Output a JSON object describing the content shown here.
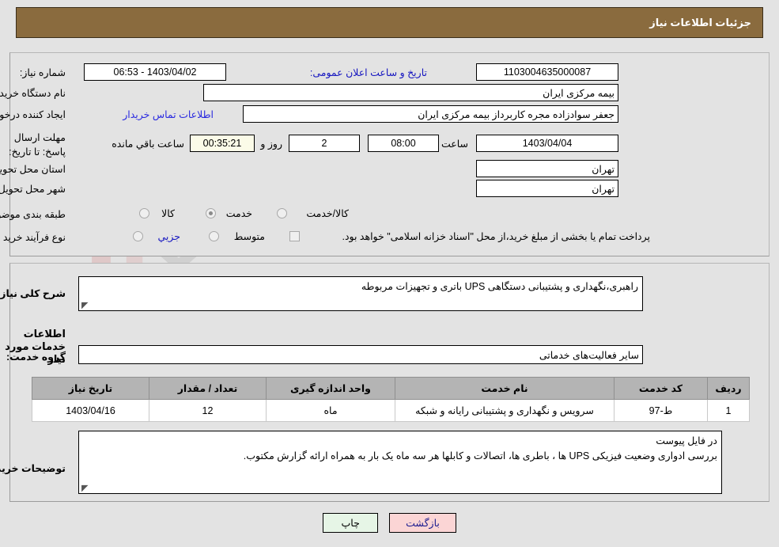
{
  "header": {
    "title": "جزئیات اطلاعات نیاز"
  },
  "watermark": {
    "text": "AnaTender.net"
  },
  "top_panel": {
    "need_number_label": "شماره نیاز:",
    "need_number_value": "1103004635000087",
    "public_announce_label": "تاریخ و ساعت اعلان عمومی:",
    "public_announce_value": "1403/04/02 - 06:53",
    "buyer_org_label": "نام دستگاه خریدار:",
    "buyer_org_value": "بیمه مرکزی ایران",
    "creator_label": "ایجاد کننده درخواست:",
    "creator_value": "جعفر سوادزاده مجره کاربرداز بیمه مرکزی ایران",
    "contact_link": "اطلاعات تماس خریدار",
    "deadline_label": "مهلت ارسال پاسخ: تا تاریخ:",
    "deadline_date": "1403/04/04",
    "deadline_hour_label": "ساعت",
    "deadline_hour_value": "08:00",
    "days_value": "2",
    "days_label": "روز و",
    "countdown_value": "00:35:21",
    "countdown_label": "ساعت باقي مانده",
    "province_label": "استان محل تحویل:",
    "province_value": "تهران",
    "city_label": "شهر محل تحویل:",
    "city_value": "تهران",
    "category_label": "طبقه بندی موضوعی:",
    "category_options": [
      {
        "label": "کالا",
        "selected": false
      },
      {
        "label": "خدمت",
        "selected": true
      },
      {
        "label": "کالا/خدمت",
        "selected": false
      }
    ],
    "process_label": "نوع فرآیند خرید :",
    "process_options": [
      {
        "label": "جزیي",
        "selected": false
      },
      {
        "label": "متوسط",
        "selected": false
      }
    ],
    "payment_checkbox_label": "پرداخت تمام یا بخشی از مبلغ خرید،از محل \"اسناد خزانه اسلامی\" خواهد بود."
  },
  "middle_panel": {
    "overall_need_label": "شرح کلی نیاز:",
    "overall_need_value": "راهبری،نگهداری و پشتیبانی دستگاهی UPS باتری و تجهیزات مربوطه",
    "services_section_title": "اطلاعات خدمات مورد نیاز",
    "service_group_label": "گروه خدمت:",
    "service_group_value": "سایر فعالیت‌های خدماتی",
    "table": {
      "columns": [
        "ردیف",
        "کد خدمت",
        "نام خدمت",
        "واحد اندازه گیری",
        "تعداد / مقدار",
        "تاریخ نیاز"
      ],
      "rows": [
        [
          "1",
          "ط-97",
          "سرویس و نگهداری و پشتیبانی رایانه و شبکه",
          "ماه",
          "12",
          "1403/04/16"
        ]
      ]
    },
    "buyer_notes_label": "توضیحات خریدار:",
    "buyer_notes_line1": "در فایل پیوست",
    "buyer_notes_line2": "بررسی ادواری وضعیت فیزیکی  UPS  ها ، باطری ها،  اتصالات و کابلها  هر سه ماه یک بار به همراه ارائه گزارش مکتوب."
  },
  "footer": {
    "print_label": "چاپ",
    "back_label": "بازگشت"
  }
}
